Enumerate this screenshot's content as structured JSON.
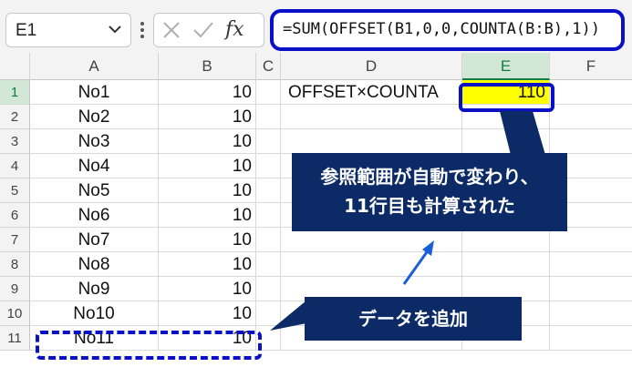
{
  "formula_bar": {
    "name_box": "E1",
    "formula": "=SUM(OFFSET(B1,0,0,COUNTA(B:B),1))",
    "fx_label": "fx"
  },
  "columns": [
    "A",
    "B",
    "C",
    "D",
    "E",
    "F"
  ],
  "rows": [
    {
      "num": "1",
      "a": "No1",
      "b": "10",
      "d": "OFFSET×COUNTA",
      "e": "110"
    },
    {
      "num": "2",
      "a": "No2",
      "b": "10"
    },
    {
      "num": "3",
      "a": "No3",
      "b": "10"
    },
    {
      "num": "4",
      "a": "No4",
      "b": "10"
    },
    {
      "num": "5",
      "a": "No5",
      "b": "10"
    },
    {
      "num": "6",
      "a": "No6",
      "b": "10"
    },
    {
      "num": "7",
      "a": "No7",
      "b": "10"
    },
    {
      "num": "8",
      "a": "No8",
      "b": "10"
    },
    {
      "num": "9",
      "a": "No9",
      "b": "10"
    },
    {
      "num": "10",
      "a": "No10",
      "b": "10"
    },
    {
      "num": "11",
      "a": "No11",
      "b": "10"
    }
  ],
  "callouts": {
    "top_line1": "参照範囲が自動で変わり、",
    "top_line2": "11行目も計算された",
    "bottom": "データを追加"
  },
  "colors": {
    "accent_blue": "#0a10c8",
    "callout_bg": "#0b2a66",
    "highlight_yellow": "#ffff00",
    "selected_header_green": "#107c41"
  }
}
